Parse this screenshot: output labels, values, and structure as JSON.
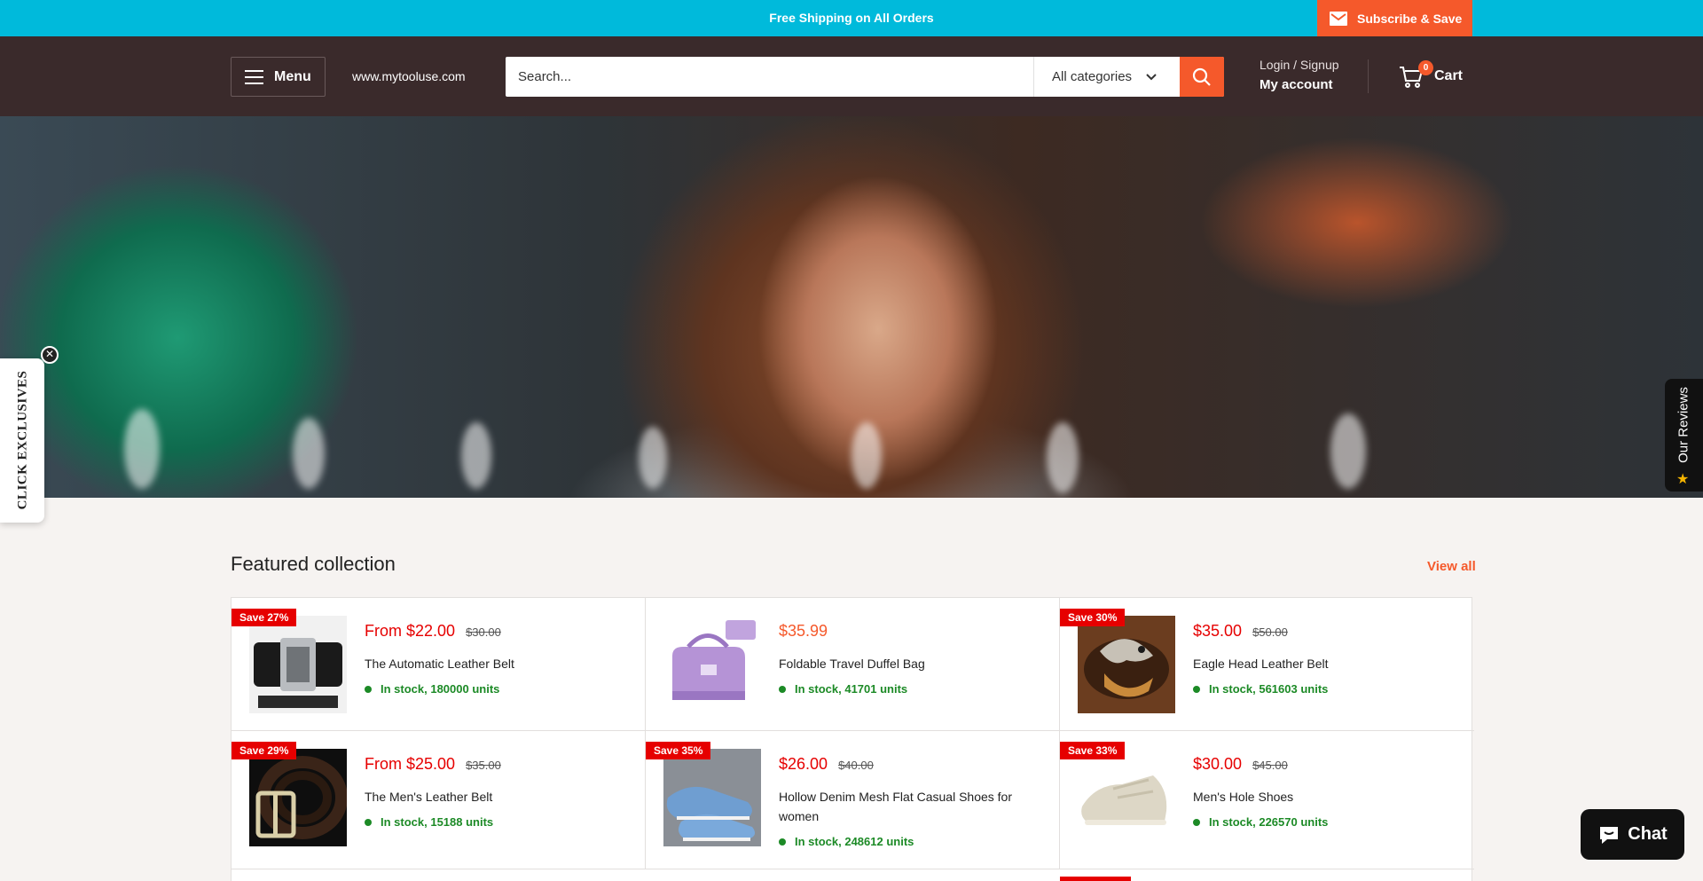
{
  "announcement": {
    "text": "Free Shipping on All Orders",
    "subscribe_label": "Subscribe & Save"
  },
  "header": {
    "menu_label": "Menu",
    "site_url": "www.mytooluse.com",
    "search_placeholder": "Search...",
    "category_label": "All categories",
    "login_label": "Login / Signup",
    "account_label": "My account",
    "cart_label": "Cart",
    "cart_count": "0"
  },
  "side_tabs": {
    "exclusives_label": "CLICK EXCLUSIVES",
    "reviews_label": "Our Reviews"
  },
  "featured": {
    "title": "Featured collection",
    "view_all": "View all",
    "products": [
      {
        "badge": "Save 27%",
        "price": "From $22.00",
        "old_price": "$30.00",
        "name": "The Automatic Leather Belt",
        "stock": "In stock, 180000 units",
        "icon": "belt-automatic"
      },
      {
        "badge": "",
        "price": "$35.99",
        "old_price": "",
        "name": "Foldable Travel Duffel Bag",
        "stock": "In stock, 41701 units",
        "icon": "duffel-bag"
      },
      {
        "badge": "Save 30%",
        "price": "$35.00",
        "old_price": "$50.00",
        "name": "Eagle Head Leather Belt",
        "stock": "In stock, 561603 units",
        "icon": "eagle-belt"
      },
      {
        "badge": "Save 29%",
        "price": "From $25.00",
        "old_price": "$35.00",
        "name": "The Men's Leather Belt",
        "stock": "In stock, 15188 units",
        "icon": "leather-belt"
      },
      {
        "badge": "Save 35%",
        "price": "$26.00",
        "old_price": "$40.00",
        "name": "Hollow Denim Mesh Flat Casual Shoes for women",
        "stock": "In stock, 248612 units",
        "icon": "denim-shoes"
      },
      {
        "badge": "Save 33%",
        "price": "$30.00",
        "old_price": "$45.00",
        "name": "Men's Hole Shoes",
        "stock": "In stock, 226570 units",
        "icon": "hole-shoes"
      }
    ]
  },
  "chat": {
    "label": "Chat"
  },
  "colors": {
    "announcement_bg": "#00badb",
    "header_bg": "#3a2a2b",
    "accent": "#f5592b",
    "sale_red": "#e60000",
    "stock_green": "#1c8a26"
  }
}
